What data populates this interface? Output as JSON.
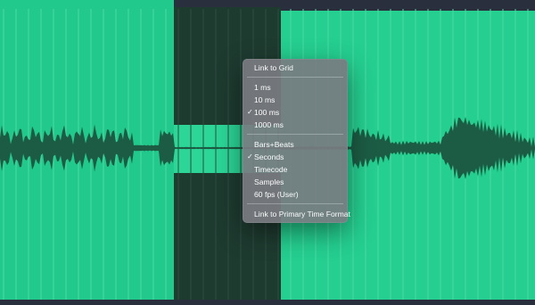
{
  "colors": {
    "track_green": "#20c68a",
    "track_green_light": "#2bd697",
    "selection_dark": "#1f3a2f",
    "waveform": "#1c5e47",
    "waveform_selected": "#2fd89a",
    "grid_line": "#5fdcad",
    "menu_bg": "#7a7c82",
    "menu_text": "#fbfbfb"
  },
  "context_menu": {
    "link_to_grid": "Link to Grid",
    "intervals": [
      {
        "label": "1 ms",
        "checked": false
      },
      {
        "label": "10 ms",
        "checked": false
      },
      {
        "label": "100 ms",
        "checked": true
      },
      {
        "label": "1000 ms",
        "checked": false
      }
    ],
    "formats": [
      {
        "label": "Bars+Beats",
        "checked": false
      },
      {
        "label": "Seconds",
        "checked": true
      },
      {
        "label": "Timecode",
        "checked": false
      },
      {
        "label": "Samples",
        "checked": false
      },
      {
        "label": "60 fps (User)",
        "checked": false
      }
    ],
    "link_to_primary": "Link to Primary Time Format",
    "check_glyph": "✓"
  }
}
